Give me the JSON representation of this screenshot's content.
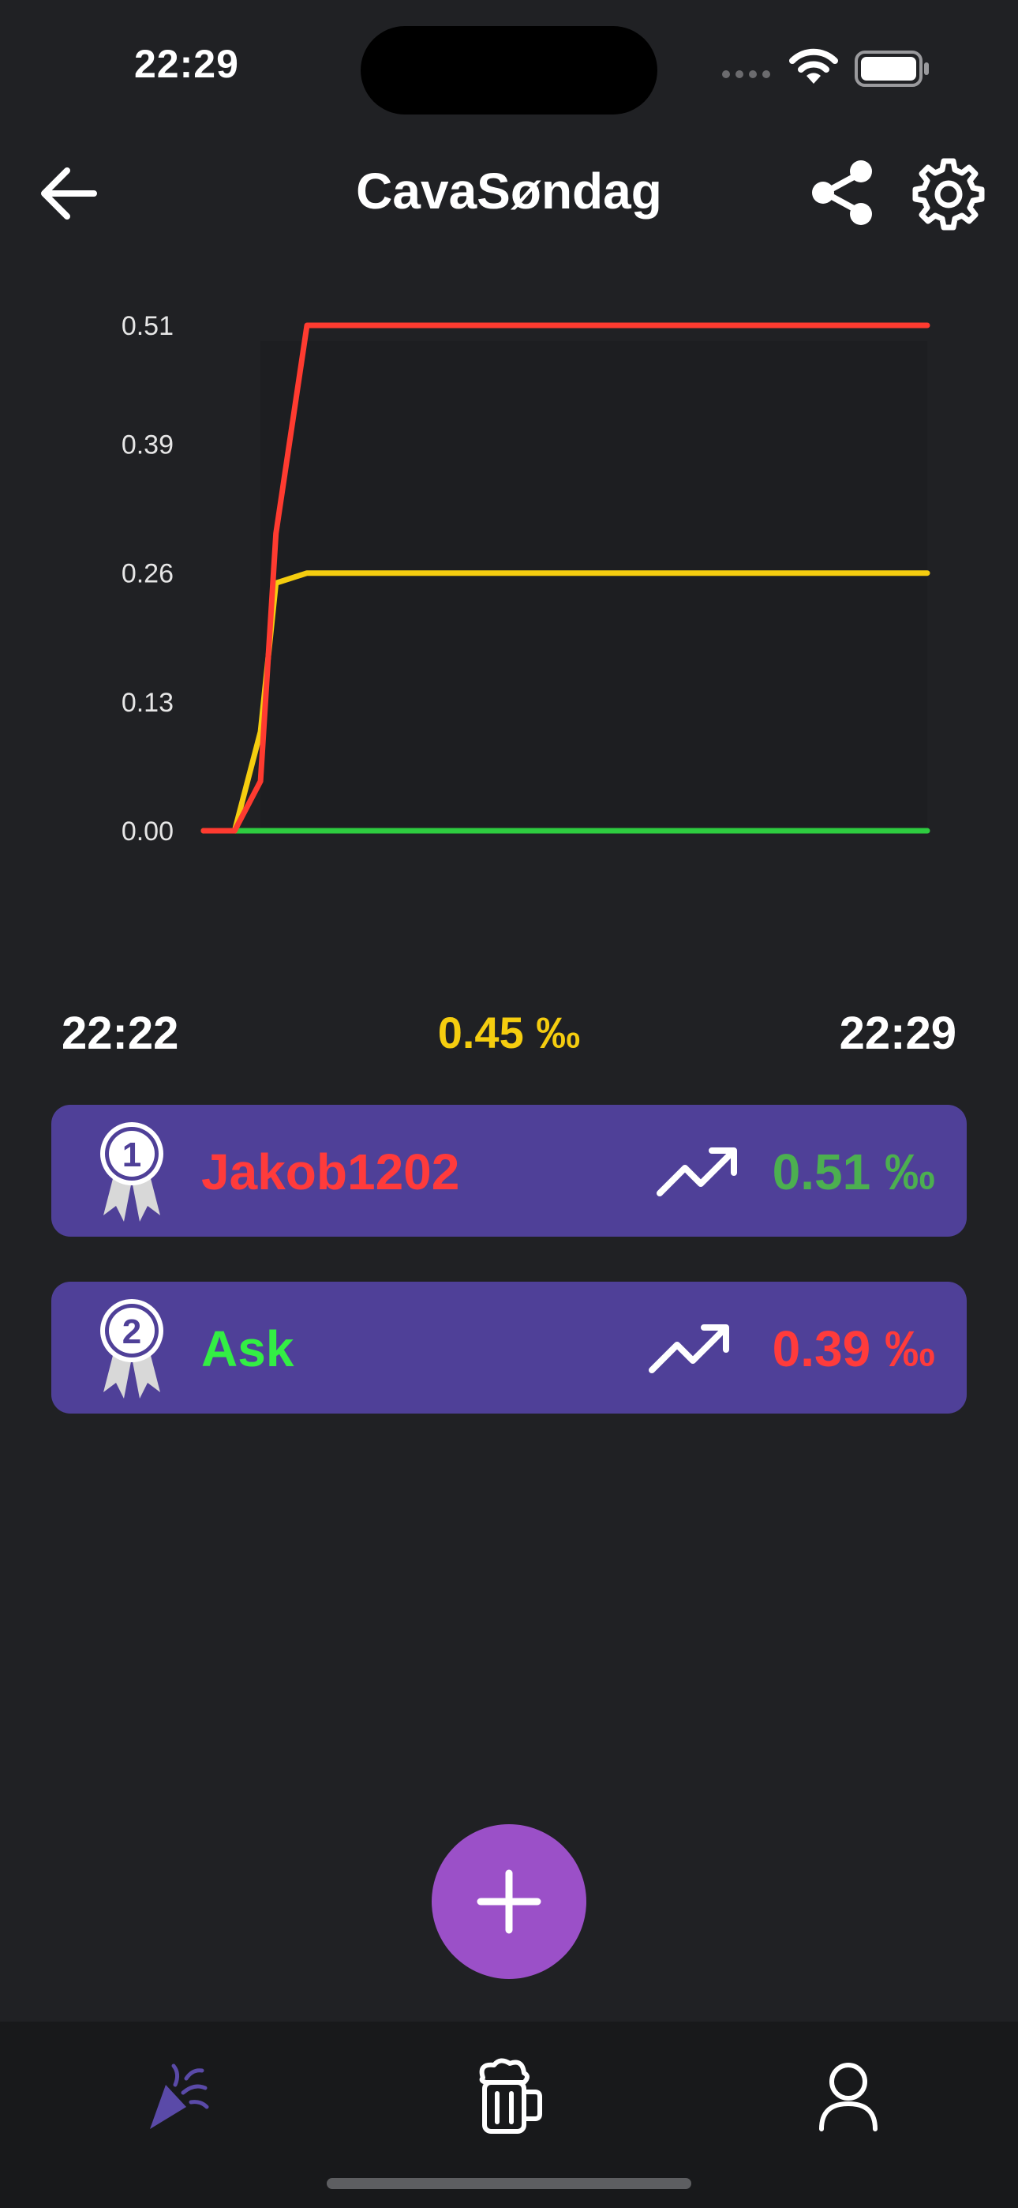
{
  "status_bar": {
    "time": "22:29"
  },
  "header": {
    "title": "CavaSøndag"
  },
  "chart_data": {
    "type": "line",
    "title": "",
    "xlabel": "",
    "ylabel": "",
    "y_ticks": [
      "0.51",
      "0.39",
      "0.26",
      "0.13",
      "0.00"
    ],
    "ylim": [
      0,
      0.51
    ],
    "x_range_labels": [
      "22:22",
      "22:29"
    ],
    "x": [
      0,
      0.3,
      0.55,
      0.7,
      1,
      2,
      3,
      4,
      5,
      6,
      6.5,
      7
    ],
    "series": [
      {
        "color": "#ff3b30",
        "values": [
          0,
          0.0,
          0.05,
          0.3,
          0.51,
          0.51,
          0.51,
          0.51,
          0.51,
          0.51,
          0.51,
          0.51
        ]
      },
      {
        "color": "#f5cd0f",
        "values": [
          0,
          0.0,
          0.1,
          0.25,
          0.26,
          0.26,
          0.26,
          0.26,
          0.26,
          0.26,
          0.26,
          0.26
        ]
      },
      {
        "color": "#2ecc40",
        "values": [
          0,
          0.0,
          0.0,
          0.0,
          0.0,
          0.0,
          0.0,
          0.0,
          0.0,
          0.0,
          0.0,
          0.0
        ]
      }
    ],
    "grid": false,
    "legend": "none"
  },
  "summary": {
    "start_time": "22:22",
    "current_value": "0.45 ‰",
    "end_time": "22:29"
  },
  "leaderboard": [
    {
      "rank": "1",
      "name": "Jakob1202",
      "name_color": "#ff3b3b",
      "value": "0.51 ‰",
      "value_color": "#4caf50",
      "trend_icon": "trending-up-icon"
    },
    {
      "rank": "2",
      "name": "Ask",
      "name_color": "#33ee44",
      "value": "0.39 ‰",
      "value_color": "#ff3b3b",
      "trend_icon": "trending-up-icon"
    }
  ],
  "colors": {
    "background": "#202124",
    "row_background": "#4f4098",
    "fab": "#9b50c8",
    "nav_active": "#5a4aa8"
  },
  "bottom_nav": [
    {
      "icon": "party-popper-icon",
      "active": true
    },
    {
      "icon": "beer-mug-icon",
      "active": false
    },
    {
      "icon": "profile-icon",
      "active": false
    }
  ]
}
